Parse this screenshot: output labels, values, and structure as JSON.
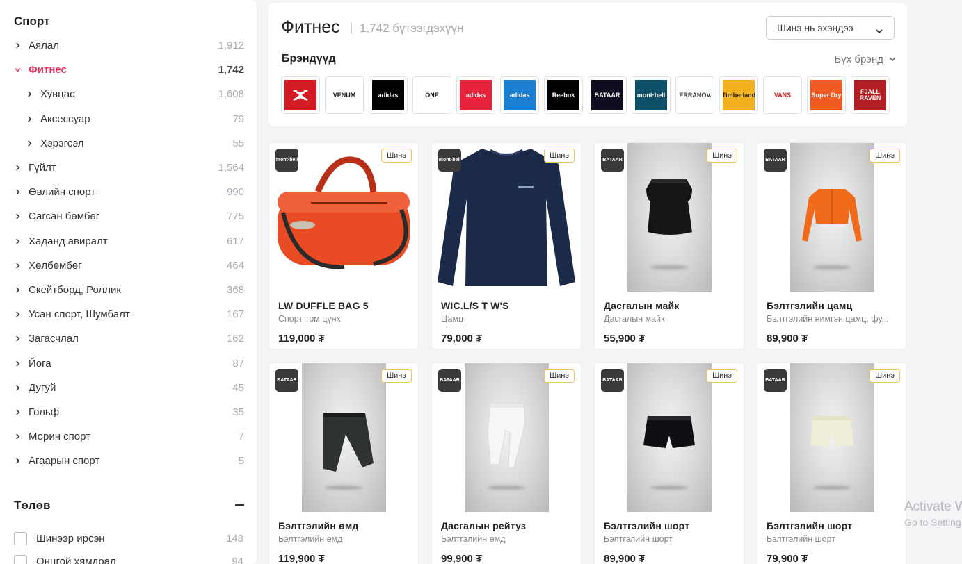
{
  "sidebar": {
    "title": "Спорт",
    "categories": [
      {
        "label": "Аялал",
        "count": "1,912",
        "level": 0,
        "expanded": false,
        "active": false
      },
      {
        "label": "Фитнес",
        "count": "1,742",
        "level": 0,
        "expanded": true,
        "active": true
      },
      {
        "label": "Хувцас",
        "count": "1,608",
        "level": 1,
        "expanded": false,
        "active": false
      },
      {
        "label": "Аксессуар",
        "count": "79",
        "level": 1,
        "expanded": false,
        "active": false
      },
      {
        "label": "Хэрэгсэл",
        "count": "55",
        "level": 1,
        "expanded": false,
        "active": false
      },
      {
        "label": "Гүйлт",
        "count": "1,564",
        "level": 0,
        "expanded": false,
        "active": false
      },
      {
        "label": "Өвлийн спорт",
        "count": "990",
        "level": 0,
        "expanded": false,
        "active": false
      },
      {
        "label": "Сагсан бөмбөг",
        "count": "775",
        "level": 0,
        "expanded": false,
        "active": false
      },
      {
        "label": "Хаданд авиралт",
        "count": "617",
        "level": 0,
        "expanded": false,
        "active": false
      },
      {
        "label": "Хөлбөмбөг",
        "count": "464",
        "level": 0,
        "expanded": false,
        "active": false
      },
      {
        "label": "Скейтборд, Роллик",
        "count": "368",
        "level": 0,
        "expanded": false,
        "active": false
      },
      {
        "label": "Усан спорт, Шумбалт",
        "count": "167",
        "level": 0,
        "expanded": false,
        "active": false
      },
      {
        "label": "Загасчлал",
        "count": "162",
        "level": 0,
        "expanded": false,
        "active": false
      },
      {
        "label": "Йога",
        "count": "87",
        "level": 0,
        "expanded": false,
        "active": false
      },
      {
        "label": "Дугуй",
        "count": "45",
        "level": 0,
        "expanded": false,
        "active": false
      },
      {
        "label": "Гольф",
        "count": "35",
        "level": 0,
        "expanded": false,
        "active": false
      },
      {
        "label": "Морин спорт",
        "count": "7",
        "level": 0,
        "expanded": false,
        "active": false
      },
      {
        "label": "Агаарын спорт",
        "count": "5",
        "level": 0,
        "expanded": false,
        "active": false
      }
    ],
    "status": {
      "title": "Төлөв",
      "options": [
        {
          "label": "Шинээр ирсэн",
          "count": "148"
        },
        {
          "label": "Онцгой хямдрал",
          "count": "94"
        }
      ]
    }
  },
  "header": {
    "title": "Фитнес",
    "count": "1,742 бүтээгдэхүүн",
    "sort_label": "Шинэ нь эхэндээ",
    "brands_title": "Брэндүүд",
    "all_brands_label": "Бүх брэнд"
  },
  "brands": [
    {
      "name": "Under Armour",
      "text": "",
      "bg": "#d51c24",
      "fg": "#ffffff"
    },
    {
      "name": "Venum",
      "text": "VENUM",
      "bg": "#ffffff",
      "fg": "#111111"
    },
    {
      "name": "Adidas",
      "text": "adidas",
      "bg": "#000000",
      "fg": "#ffffff"
    },
    {
      "name": "ONE Championship",
      "text": "ONE",
      "bg": "#ffffff",
      "fg": "#111111"
    },
    {
      "name": "Adidas Young Athletes",
      "text": "adidas",
      "bg": "#e8243c",
      "fg": "#ffffff"
    },
    {
      "name": "Adidas Originals",
      "text": "adidas",
      "bg": "#1a7fd0",
      "fg": "#ffffff"
    },
    {
      "name": "Reebok",
      "text": "Reebok",
      "bg": "#000000",
      "fg": "#ffffff"
    },
    {
      "name": "BATAAR",
      "text": "BATAAR",
      "bg": "#0d0d1f",
      "fg": "#ffffff"
    },
    {
      "name": "mont-bell",
      "text": "mont·bell",
      "bg": "#0e5068",
      "fg": "#ffffff"
    },
    {
      "name": "Terranova",
      "text": "TERRANOVA",
      "bg": "#ffffff",
      "fg": "#333333"
    },
    {
      "name": "Timberland",
      "text": "Timberland",
      "bg": "#f3b21d",
      "fg": "#2a1a00"
    },
    {
      "name": "Vans",
      "text": "VANS",
      "bg": "#ffffff",
      "fg": "#cc1f24"
    },
    {
      "name": "Superdry",
      "text": "Super Dry",
      "bg": "#f15a22",
      "fg": "#ffffff"
    },
    {
      "name": "Fjallraven",
      "text": "FJALL RAVEN",
      "bg": "#b21e24",
      "fg": "#ffffff"
    }
  ],
  "products": [
    {
      "name": "LW DUFFLE BAG 5",
      "subtitle": "Спорт том цүнх",
      "price": "119,000 ₮",
      "badge": "Шинэ",
      "brand_logo": "mont·bell",
      "image": "duffle-bag",
      "photo_bg": false
    },
    {
      "name": "WIC.L/S T W'S",
      "subtitle": "Цамц",
      "price": "79,000 ₮",
      "badge": "Шинэ",
      "brand_logo": "mont·bell",
      "image": "longsleeve-navy",
      "photo_bg": false
    },
    {
      "name": "Дасгалын майк",
      "subtitle": "Дасгалын майк",
      "price": "55,900 ₮",
      "badge": "Шинэ",
      "brand_logo": "BATAAR",
      "image": "tank-black",
      "photo_bg": true
    },
    {
      "name": "Бэлтгэлийн цамц",
      "subtitle": "Бэлтгэлийн нимгэн цамц, фу...",
      "price": "89,900 ₮",
      "badge": "Шинэ",
      "brand_logo": "BATAAR",
      "image": "zip-orange",
      "photo_bg": true
    },
    {
      "name": "Бэлтгэлийн өмд",
      "subtitle": "Бэлтгэлийн өмд",
      "price": "119,900 ₮",
      "badge": "Шинэ",
      "brand_logo": "BATAAR",
      "image": "joggers-dark",
      "photo_bg": true
    },
    {
      "name": "Дасгалын рейтуз",
      "subtitle": "Бэлтгэлийн өмд",
      "price": "99,900 ₮",
      "badge": "Шинэ",
      "brand_logo": "BATAAR",
      "image": "leggings-white",
      "photo_bg": true
    },
    {
      "name": "Бэлтгэлийн шорт",
      "subtitle": "Бэлтгэлийн шорт",
      "price": "89,900 ₮",
      "badge": "Шинэ",
      "brand_logo": "BATAAR",
      "image": "shorts-black",
      "photo_bg": true
    },
    {
      "name": "Бэлтгэлийн шорт",
      "subtitle": "Бэлтгэлийн шорт",
      "price": "79,900 ₮",
      "badge": "Шинэ",
      "brand_logo": "BATAAR",
      "image": "shorts-cream",
      "photo_bg": true
    }
  ],
  "watermark": {
    "line1": "Activate W",
    "line2": "Go to Setting"
  }
}
